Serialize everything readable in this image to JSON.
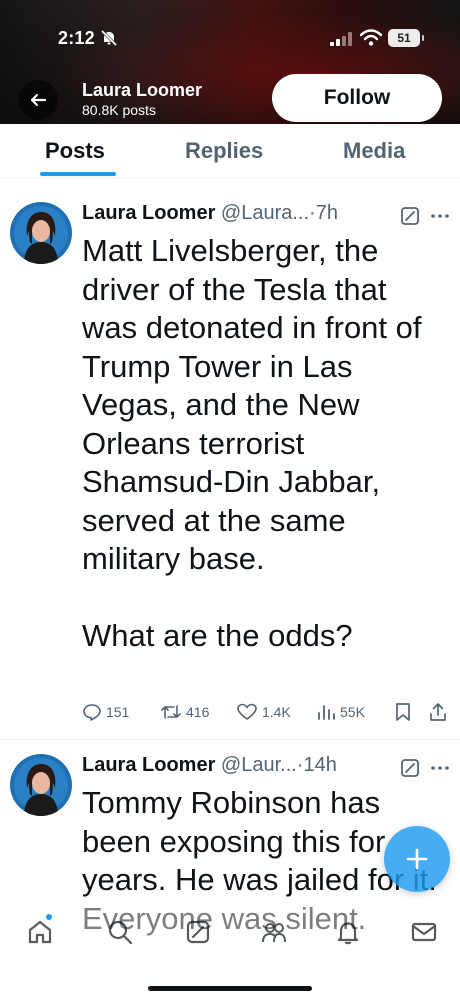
{
  "status_bar": {
    "time": "2:12",
    "battery": "51"
  },
  "header": {
    "name": "Laura Loomer",
    "posts_count": "80.8K posts",
    "follow_label": "Follow"
  },
  "tabs": [
    {
      "label": "Posts",
      "active": true
    },
    {
      "label": "Replies",
      "active": false
    },
    {
      "label": "Media",
      "active": false
    }
  ],
  "posts": [
    {
      "author": "Laura Loomer",
      "handle": "@Laura...",
      "dot": "·",
      "time": "7h",
      "text": "Matt Livelsberger, the driver of the Tesla that was detonated in front of Trump Tower in Las Vegas, and the New Orleans terrorist Shamsud-Din Jabbar, served at the same military base.\n\nWhat are the odds?",
      "replies": "151",
      "reposts": "416",
      "likes": "1.4K",
      "views": "55K"
    },
    {
      "author": "Laura Loomer",
      "handle": "@Laur...",
      "dot": "·",
      "time": "14h",
      "text": "Tommy Robinson has been exposing this for years. He was jailed for it. Everyone was silent."
    }
  ],
  "colors": {
    "accent": "#1d9bf0",
    "text": "#0f1419",
    "muted": "#536471"
  },
  "icons": [
    "back-arrow-icon",
    "grok-icon",
    "more-icon",
    "reply-icon",
    "repost-icon",
    "like-icon",
    "views-icon",
    "bookmark-icon",
    "share-icon",
    "home-icon",
    "search-icon",
    "people-icon",
    "bell-icon",
    "mail-icon",
    "plus-icon"
  ]
}
